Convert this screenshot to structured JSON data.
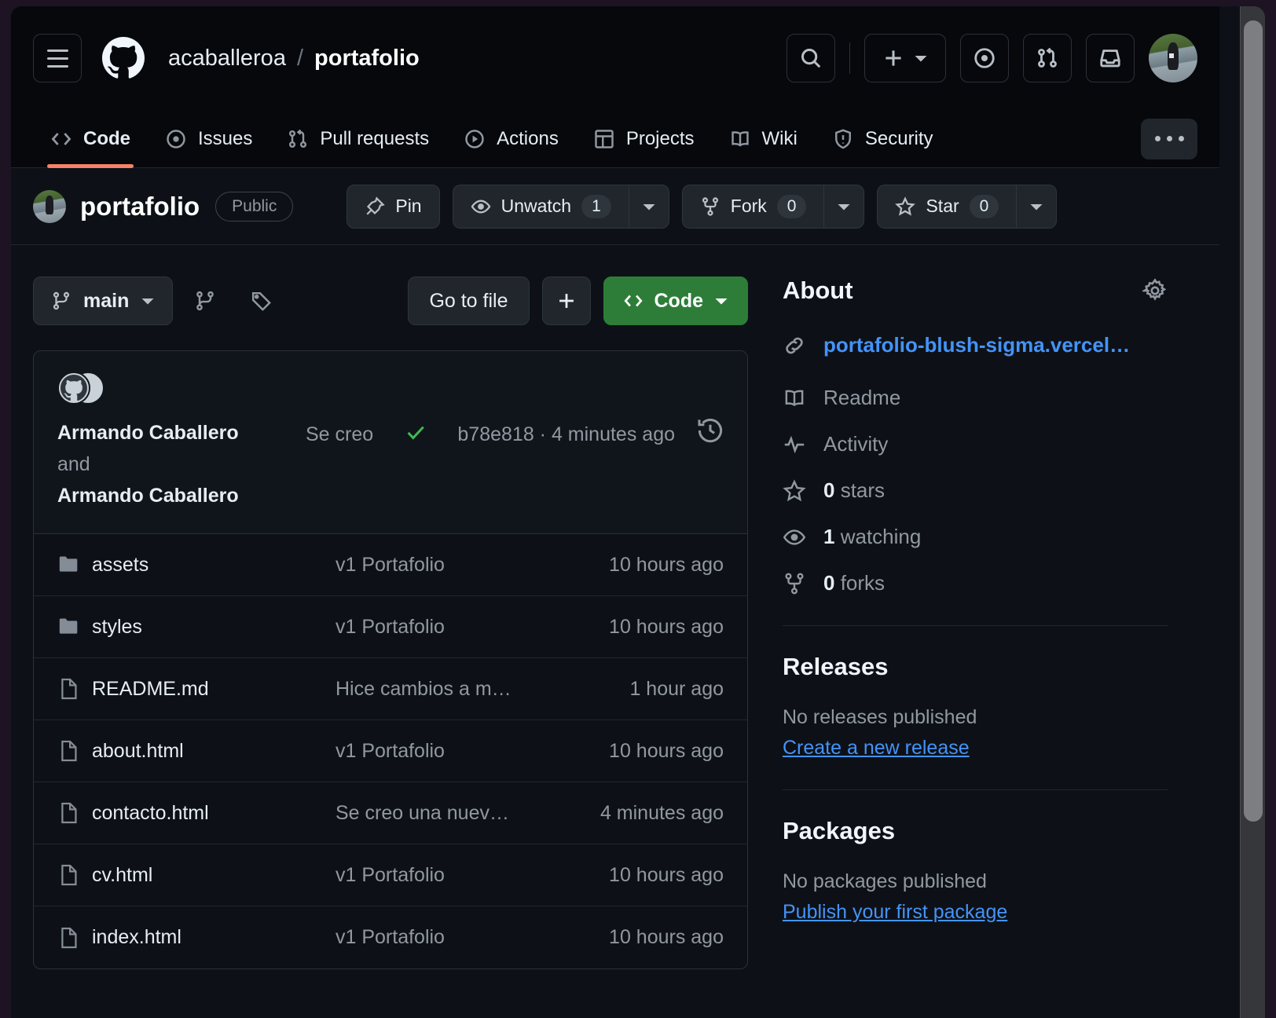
{
  "header": {
    "menu_icon": "hamburger-icon",
    "logo_icon": "github-mark-icon",
    "owner": "acaballeroa",
    "separator": "/",
    "repo": "portafolio",
    "search_icon": "search-icon",
    "create_icon": "plus-icon",
    "create_caret_icon": "chevron-down-icon",
    "issues_icon": "issue-opened-icon",
    "pulls_icon": "git-pull-request-icon",
    "inbox_icon": "inbox-icon",
    "avatar": "user-avatar"
  },
  "nav": {
    "tabs": [
      {
        "label": "Code",
        "icon": "code-icon",
        "active": true
      },
      {
        "label": "Issues",
        "icon": "issue-opened-icon",
        "active": false
      },
      {
        "label": "Pull requests",
        "icon": "git-pull-request-icon",
        "active": false
      },
      {
        "label": "Actions",
        "icon": "play-icon",
        "active": false
      },
      {
        "label": "Projects",
        "icon": "table-icon",
        "active": false
      },
      {
        "label": "Wiki",
        "icon": "book-icon",
        "active": false
      },
      {
        "label": "Security",
        "icon": "shield-icon",
        "active": false
      }
    ],
    "more_label": "More options",
    "active_underline_color": "#f78166"
  },
  "repo": {
    "name": "portafolio",
    "visibility": "Public",
    "pin_label": "Pin",
    "pin_icon": "pin-icon",
    "watch_label": "Unwatch",
    "watch_count": "1",
    "watch_icon": "eye-icon",
    "fork_label": "Fork",
    "fork_count": "0",
    "fork_icon": "repo-forked-icon",
    "star_label": "Star",
    "star_count": "0",
    "star_icon": "star-icon",
    "caret_icon": "chevron-down-icon"
  },
  "toolbar": {
    "branch": "main",
    "branch_icon": "git-branch-icon",
    "branches_icon": "git-branch-icon",
    "tags_icon": "tag-icon",
    "go_to_file": "Go to file",
    "add_file": "+",
    "code_label": "Code",
    "code_icon": "code-icon",
    "code_color": "#2d7d39"
  },
  "commit": {
    "author_1": "Armando Caballero",
    "and": "and",
    "author_2": "Armando Caballero",
    "message": "Se creo ...",
    "status_icon": "check-icon",
    "status_color": "#3fb950",
    "sha": "b78e818",
    "dot": "·",
    "relative_time": "4 minutes ago",
    "history_icon": "history-icon"
  },
  "files": [
    {
      "name": "assets",
      "type": "folder",
      "icon": "folder-icon",
      "commit": "v1 Portafolio",
      "time": "10 hours ago"
    },
    {
      "name": "styles",
      "type": "folder",
      "icon": "folder-icon",
      "commit": "v1 Portafolio",
      "time": "10 hours ago"
    },
    {
      "name": "README.md",
      "type": "file",
      "icon": "file-icon",
      "commit": "Hice cambios a m…",
      "time": "1 hour ago"
    },
    {
      "name": "about.html",
      "type": "file",
      "icon": "file-icon",
      "commit": "v1 Portafolio",
      "time": "10 hours ago"
    },
    {
      "name": "contacto.html",
      "type": "file",
      "icon": "file-icon",
      "commit": "Se creo una nuev…",
      "time": "4 minutes ago"
    },
    {
      "name": "cv.html",
      "type": "file",
      "icon": "file-icon",
      "commit": "v1 Portafolio",
      "time": "10 hours ago"
    },
    {
      "name": "index.html",
      "type": "file",
      "icon": "file-icon",
      "commit": "v1 Portafolio",
      "time": "10 hours ago"
    }
  ],
  "about": {
    "title": "About",
    "settings_icon": "gear-icon",
    "link_icon": "link-icon",
    "website": "portafolio-blush-sigma.vercel…",
    "website_color": "#4493f8",
    "items": [
      {
        "label": "Readme",
        "icon": "book-icon",
        "strong": ""
      },
      {
        "label": "Activity",
        "icon": "pulse-icon",
        "strong": ""
      },
      {
        "label": "stars",
        "icon": "star-icon",
        "strong": "0"
      },
      {
        "label": "watching",
        "icon": "eye-icon",
        "strong": "1"
      },
      {
        "label": "forks",
        "icon": "repo-forked-icon",
        "strong": "0"
      }
    ]
  },
  "releases": {
    "title": "Releases",
    "empty": "No releases published",
    "action": "Create a new release"
  },
  "packages": {
    "title": "Packages",
    "empty": "No packages published",
    "action": "Publish your first package"
  },
  "scrollbar": {
    "name": "vertical-scrollbar"
  }
}
